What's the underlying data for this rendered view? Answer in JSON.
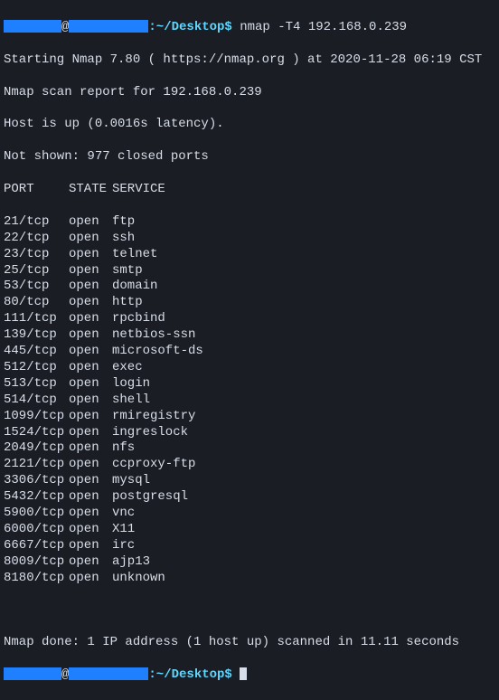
{
  "prompt1": {
    "at": "@",
    "path": ":~/Desktop$",
    "command": " nmap -T4 192.168.0.239"
  },
  "header": {
    "line1": "Starting Nmap 7.80 ( https://nmap.org ) at 2020-11-28 06:19 CST",
    "line2": "Nmap scan report for 192.168.0.239",
    "line3": "Host is up (0.0016s latency).",
    "line4": "Not shown: 977 closed ports",
    "columns": {
      "port": "PORT",
      "state": "STATE",
      "service": "SERVICE"
    }
  },
  "ports": [
    {
      "port": "21/tcp",
      "state": "open",
      "service": "ftp"
    },
    {
      "port": "22/tcp",
      "state": "open",
      "service": "ssh"
    },
    {
      "port": "23/tcp",
      "state": "open",
      "service": "telnet"
    },
    {
      "port": "25/tcp",
      "state": "open",
      "service": "smtp"
    },
    {
      "port": "53/tcp",
      "state": "open",
      "service": "domain"
    },
    {
      "port": "80/tcp",
      "state": "open",
      "service": "http"
    },
    {
      "port": "111/tcp",
      "state": "open",
      "service": "rpcbind"
    },
    {
      "port": "139/tcp",
      "state": "open",
      "service": "netbios-ssn"
    },
    {
      "port": "445/tcp",
      "state": "open",
      "service": "microsoft-ds"
    },
    {
      "port": "512/tcp",
      "state": "open",
      "service": "exec"
    },
    {
      "port": "513/tcp",
      "state": "open",
      "service": "login"
    },
    {
      "port": "514/tcp",
      "state": "open",
      "service": "shell"
    },
    {
      "port": "1099/tcp",
      "state": "open",
      "service": "rmiregistry"
    },
    {
      "port": "1524/tcp",
      "state": "open",
      "service": "ingreslock"
    },
    {
      "port": "2049/tcp",
      "state": "open",
      "service": "nfs"
    },
    {
      "port": "2121/tcp",
      "state": "open",
      "service": "ccproxy-ftp"
    },
    {
      "port": "3306/tcp",
      "state": "open",
      "service": "mysql"
    },
    {
      "port": "5432/tcp",
      "state": "open",
      "service": "postgresql"
    },
    {
      "port": "5900/tcp",
      "state": "open",
      "service": "vnc"
    },
    {
      "port": "6000/tcp",
      "state": "open",
      "service": "X11"
    },
    {
      "port": "6667/tcp",
      "state": "open",
      "service": "irc"
    },
    {
      "port": "8009/tcp",
      "state": "open",
      "service": "ajp13"
    },
    {
      "port": "8180/tcp",
      "state": "open",
      "service": "unknown"
    }
  ],
  "footer": {
    "done": "Nmap done: 1 IP address (1 host up) scanned in 11.11 seconds"
  },
  "prompt2": {
    "at": "@",
    "path": ":~/Desktop$",
    "command": " "
  }
}
